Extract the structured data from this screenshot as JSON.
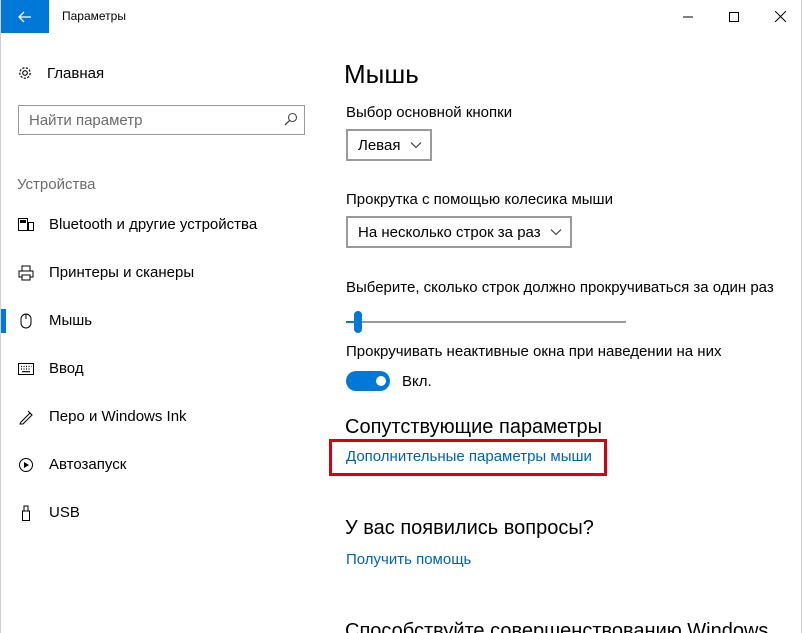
{
  "window": {
    "title": "Параметры",
    "accent_color": "#0078d7",
    "highlight_color": "#d7000f",
    "controls": [
      "minimize-icon",
      "maximize-icon",
      "close-icon"
    ]
  },
  "sidebar": {
    "home_label": "Главная",
    "home_icon": "gear-icon",
    "search_placeholder": "Найти параметр",
    "search_icon": "search-icon",
    "section_title": "Устройства",
    "items": [
      {
        "label": "Bluetooth и другие устройства",
        "icon": "devices-icon",
        "active": false
      },
      {
        "label": "Принтеры и сканеры",
        "icon": "printer-icon",
        "active": false
      },
      {
        "label": "Мышь",
        "icon": "mouse-icon",
        "active": true
      },
      {
        "label": "Ввод",
        "icon": "keyboard-icon",
        "active": false
      },
      {
        "label": "Перо и Windows Ink",
        "icon": "pen-icon",
        "active": false
      },
      {
        "label": "Автозапуск",
        "icon": "autoplay-icon",
        "active": false
      },
      {
        "label": "USB",
        "icon": "usb-icon",
        "active": false
      }
    ]
  },
  "main": {
    "title": "Мышь",
    "primary_button": {
      "label": "Выбор основной кнопки",
      "value": "Левая"
    },
    "wheel_scroll": {
      "label": "Прокрутка с помощью колесика мыши",
      "value": "На несколько строк за раз"
    },
    "lines_to_scroll": {
      "label": "Выберите, сколько строк должно прокручиваться за один раз",
      "fraction": 0.03
    },
    "inactive_scroll": {
      "label": "Прокручивать неактивные окна при наведении на них",
      "state": "Вкл.",
      "on": true
    },
    "related": {
      "title": "Сопутствующие параметры",
      "link": "Дополнительные параметры мыши"
    },
    "questions": {
      "title": "У вас появились вопросы?",
      "link": "Получить помощь"
    },
    "improve": {
      "title": "Способствуйте совершенствованию Windows"
    }
  }
}
